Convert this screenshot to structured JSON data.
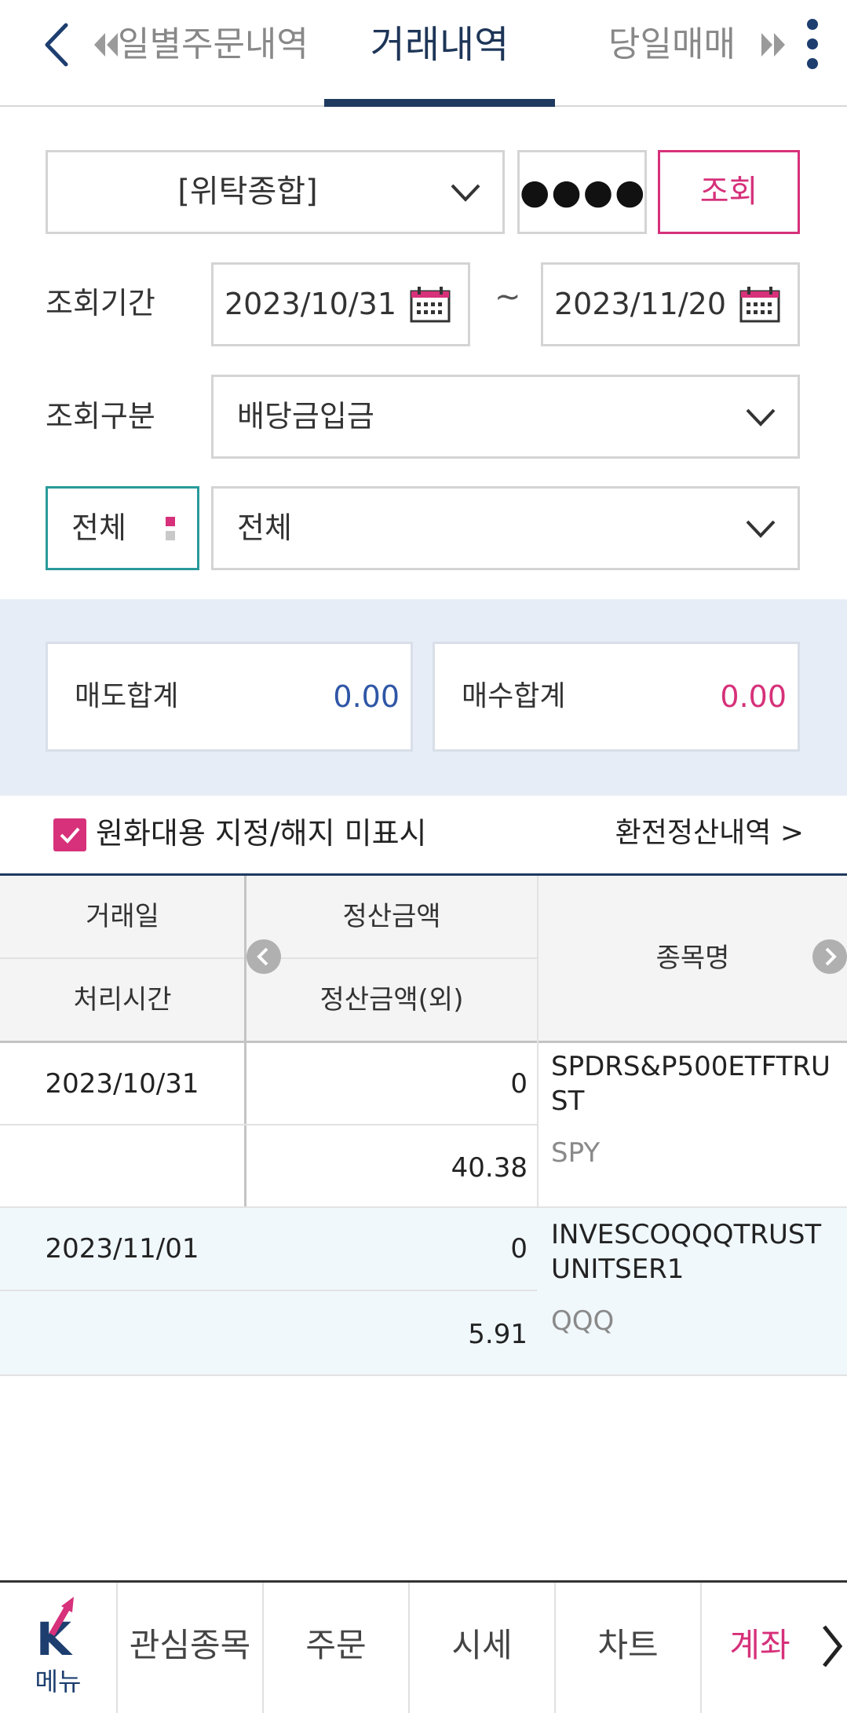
{
  "header": {
    "prev_tab": "일별주문내역",
    "active_tab": "거래내역",
    "next_tab": "당일매매"
  },
  "query": {
    "account_type": "[위탁종합]",
    "password_mask": "●●●●",
    "search_button": "조회",
    "period_label": "조회기간",
    "start_date": "2023/10/31",
    "date_separator": "~",
    "end_date": "2023/11/20",
    "category_label": "조회구분",
    "category_value": "배당금입금",
    "scope_toggle": "전체",
    "scope_value": "전체"
  },
  "summary": {
    "sell_label": "매도합계",
    "sell_value": "0.00",
    "buy_label": "매수합계",
    "buy_value": "0.00",
    "sell_color": "#2f56a6",
    "buy_color": "#d6317a"
  },
  "options": {
    "checkbox_label": "원화대용 지정/해지 미표시",
    "checked": true,
    "fx_link": "환전정산내역 >"
  },
  "table": {
    "headers": {
      "trade_date": "거래일",
      "process_time": "처리시간",
      "settlement": "정산금액",
      "settlement_foreign": "정산금액(외)",
      "name": "종목명"
    },
    "rows": [
      {
        "trade_date": "2023/10/31",
        "process_time": "",
        "settlement": "0",
        "settlement_foreign": "40.38",
        "name_line1": "SPDRS&P500ETFTRU",
        "name_line2": "ST",
        "ticker": "SPY"
      },
      {
        "trade_date": "2023/11/01",
        "process_time": "",
        "settlement": "0",
        "settlement_foreign": "5.91",
        "name_line1": "INVESCOQQQTRUST",
        "name_line2": "UNITSER1",
        "ticker": "QQQ"
      }
    ]
  },
  "bottom_nav": {
    "menu_label": "메뉴",
    "items": [
      "관심종목",
      "주문",
      "시세",
      "차트",
      "계좌"
    ]
  },
  "colors": {
    "accent": "#d6317a",
    "navy": "#1e3a5f",
    "teal": "#2a9a9a"
  }
}
